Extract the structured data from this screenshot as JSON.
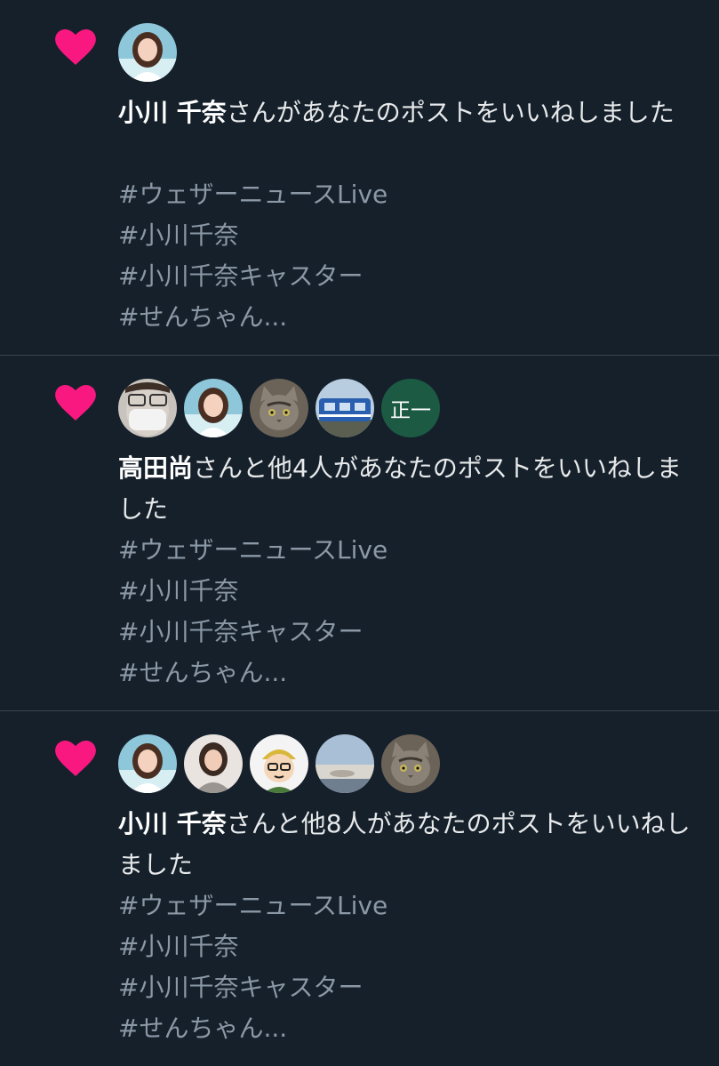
{
  "colors": {
    "background": "#15202b",
    "divider": "#38444d",
    "heart": "#f91880",
    "primary_text": "#e7e9ea",
    "secondary_text": "#8b98a5",
    "initials_avatar_bg": "#1c5a44"
  },
  "notifications": [
    {
      "icon": "heart-icon",
      "avatars": [
        {
          "type": "photo",
          "desc": "woman-avatar"
        }
      ],
      "actor_name": "小川 千奈",
      "action_text": "さんがあなたのポストをいいねしました",
      "hashtags": [
        "#ウェザーニュースLive",
        "#小川千奈",
        "#小川千奈キャスター",
        "#せんちゃん..."
      ]
    },
    {
      "icon": "heart-icon",
      "avatars": [
        {
          "type": "photo",
          "desc": "masked-person-avatar"
        },
        {
          "type": "photo",
          "desc": "woman-avatar"
        },
        {
          "type": "photo",
          "desc": "cat-avatar"
        },
        {
          "type": "photo",
          "desc": "train-avatar"
        },
        {
          "type": "initials",
          "text": "正一"
        }
      ],
      "actor_name": "高田尚",
      "action_text": "さんと他4人があなたのポストをいいねしました",
      "hashtags": [
        "#ウェザーニュースLive",
        "#小川千奈",
        "#小川千奈キャスター",
        "#せんちゃん..."
      ]
    },
    {
      "icon": "heart-icon",
      "avatars": [
        {
          "type": "photo",
          "desc": "woman-avatar"
        },
        {
          "type": "photo",
          "desc": "woman-avatar-2"
        },
        {
          "type": "photo",
          "desc": "cartoon-avatar"
        },
        {
          "type": "photo",
          "desc": "sky-avatar"
        },
        {
          "type": "photo",
          "desc": "cat-avatar"
        }
      ],
      "actor_name": "小川 千奈",
      "action_text": "さんと他8人があなたのポストをいいねしました",
      "hashtags": [
        "#ウェザーニュースLive",
        "#小川千奈",
        "#小川千奈キャスター",
        "#せんちゃん..."
      ]
    }
  ]
}
